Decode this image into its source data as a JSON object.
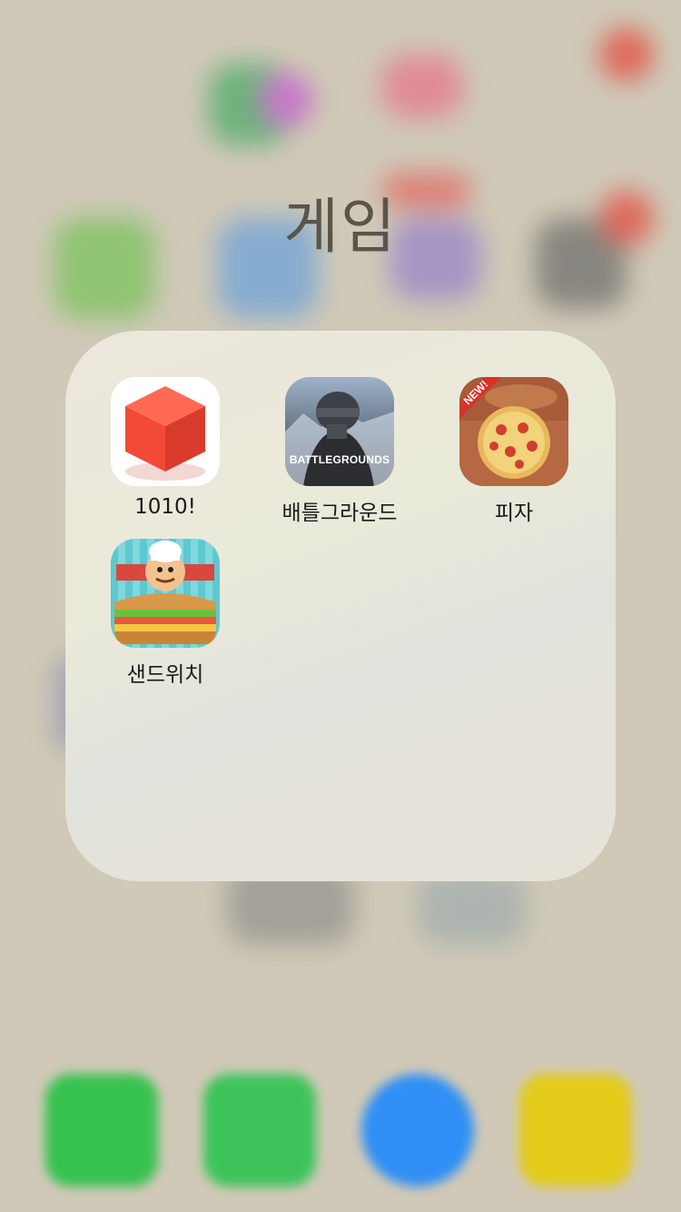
{
  "folder": {
    "title": "게임",
    "apps": [
      {
        "label": "1010!",
        "icon": "1010-cube-icon"
      },
      {
        "label": "배틀그라운드",
        "icon": "battlegrounds-icon",
        "icon_text": "BATTLEGROUNDS"
      },
      {
        "label": "피자",
        "icon": "pizza-icon",
        "badge": "NEW!"
      },
      {
        "label": "샌드위치",
        "icon": "sandwich-icon"
      }
    ]
  },
  "dock": {
    "apps": [
      {
        "icon": "phone-icon",
        "color": "#34c759"
      },
      {
        "icon": "messages-icon",
        "color": "#3cc45a"
      },
      {
        "icon": "safari-icon",
        "color": "#2f8ff5"
      },
      {
        "icon": "yellow-app-icon",
        "color": "#e8cf1a"
      }
    ]
  },
  "colors": {
    "background": "#cfc8b6",
    "folder_panel": "#ece8dc"
  }
}
